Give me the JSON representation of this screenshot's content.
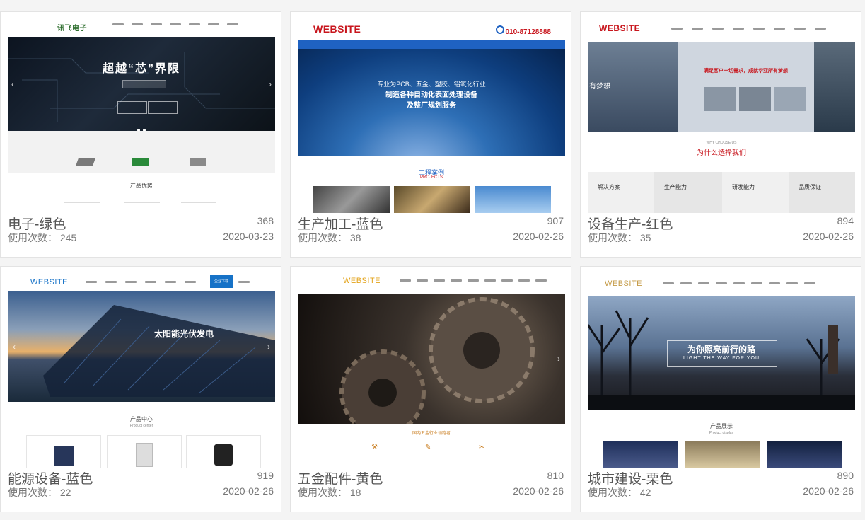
{
  "uses_label": "使用次数：",
  "templates": [
    {
      "name": "电子-绿色",
      "id_num": "368",
      "uses": "245",
      "date": "2020-03-23",
      "logo": "讯飞电子",
      "hero_text": "超越“芯”界限",
      "hero_sub": "DISTRIBUTION",
      "accent": "#3a9b3a",
      "section": "产品优势"
    },
    {
      "name": "生产加工-蓝色",
      "id_num": "907",
      "uses": "38",
      "date": "2020-02-26",
      "logo": "WEBSITE",
      "phone": "010-87128888",
      "hero_text": "专业为PCB、五金、塑胶、铝氧化行业",
      "hero_text2": "制造各种自动化表面处理设备",
      "hero_text3": "及整厂规划服务",
      "section": "工程案例",
      "section_en": "PROJECTS",
      "accent": "#1f62c2"
    },
    {
      "name": "设备生产-红色",
      "id_num": "894",
      "uses": "35",
      "date": "2020-02-26",
      "logo": "WEBSITE",
      "hero_text": "满足客户一切需求，成就华亚所有梦想",
      "hero_left": "有梦想",
      "why_en": "WHY CHOOSE US",
      "why": "为什么选择我们",
      "features": [
        "解决方案",
        "生产能力",
        "研发能力",
        "品质保证"
      ],
      "accent": "#c8161d"
    },
    {
      "name": "能源设备-蓝色",
      "id_num": "919",
      "uses": "22",
      "date": "2020-02-26",
      "logo": "WEBSITE",
      "hero_text": "太阳能光伏发电",
      "section": "产品中心",
      "section_en": "Product center",
      "active_nav": "企业下载",
      "accent": "#1672c7"
    },
    {
      "name": "五金配件-黄色",
      "id_num": "810",
      "uses": "18",
      "date": "2020-02-26",
      "logo": "WEBSITE",
      "section": "国内五金行业领跑者",
      "accent": "#e3a31a"
    },
    {
      "name": "城市建设-栗色",
      "id_num": "890",
      "uses": "42",
      "date": "2020-02-26",
      "logo": "WEBSITE",
      "hero_text": "为你照亮前行的路",
      "hero_en": "LIGHT THE WAY FOR YOU",
      "section": "产品展示",
      "section_en": "Product display",
      "accent": "#c49a45"
    }
  ]
}
